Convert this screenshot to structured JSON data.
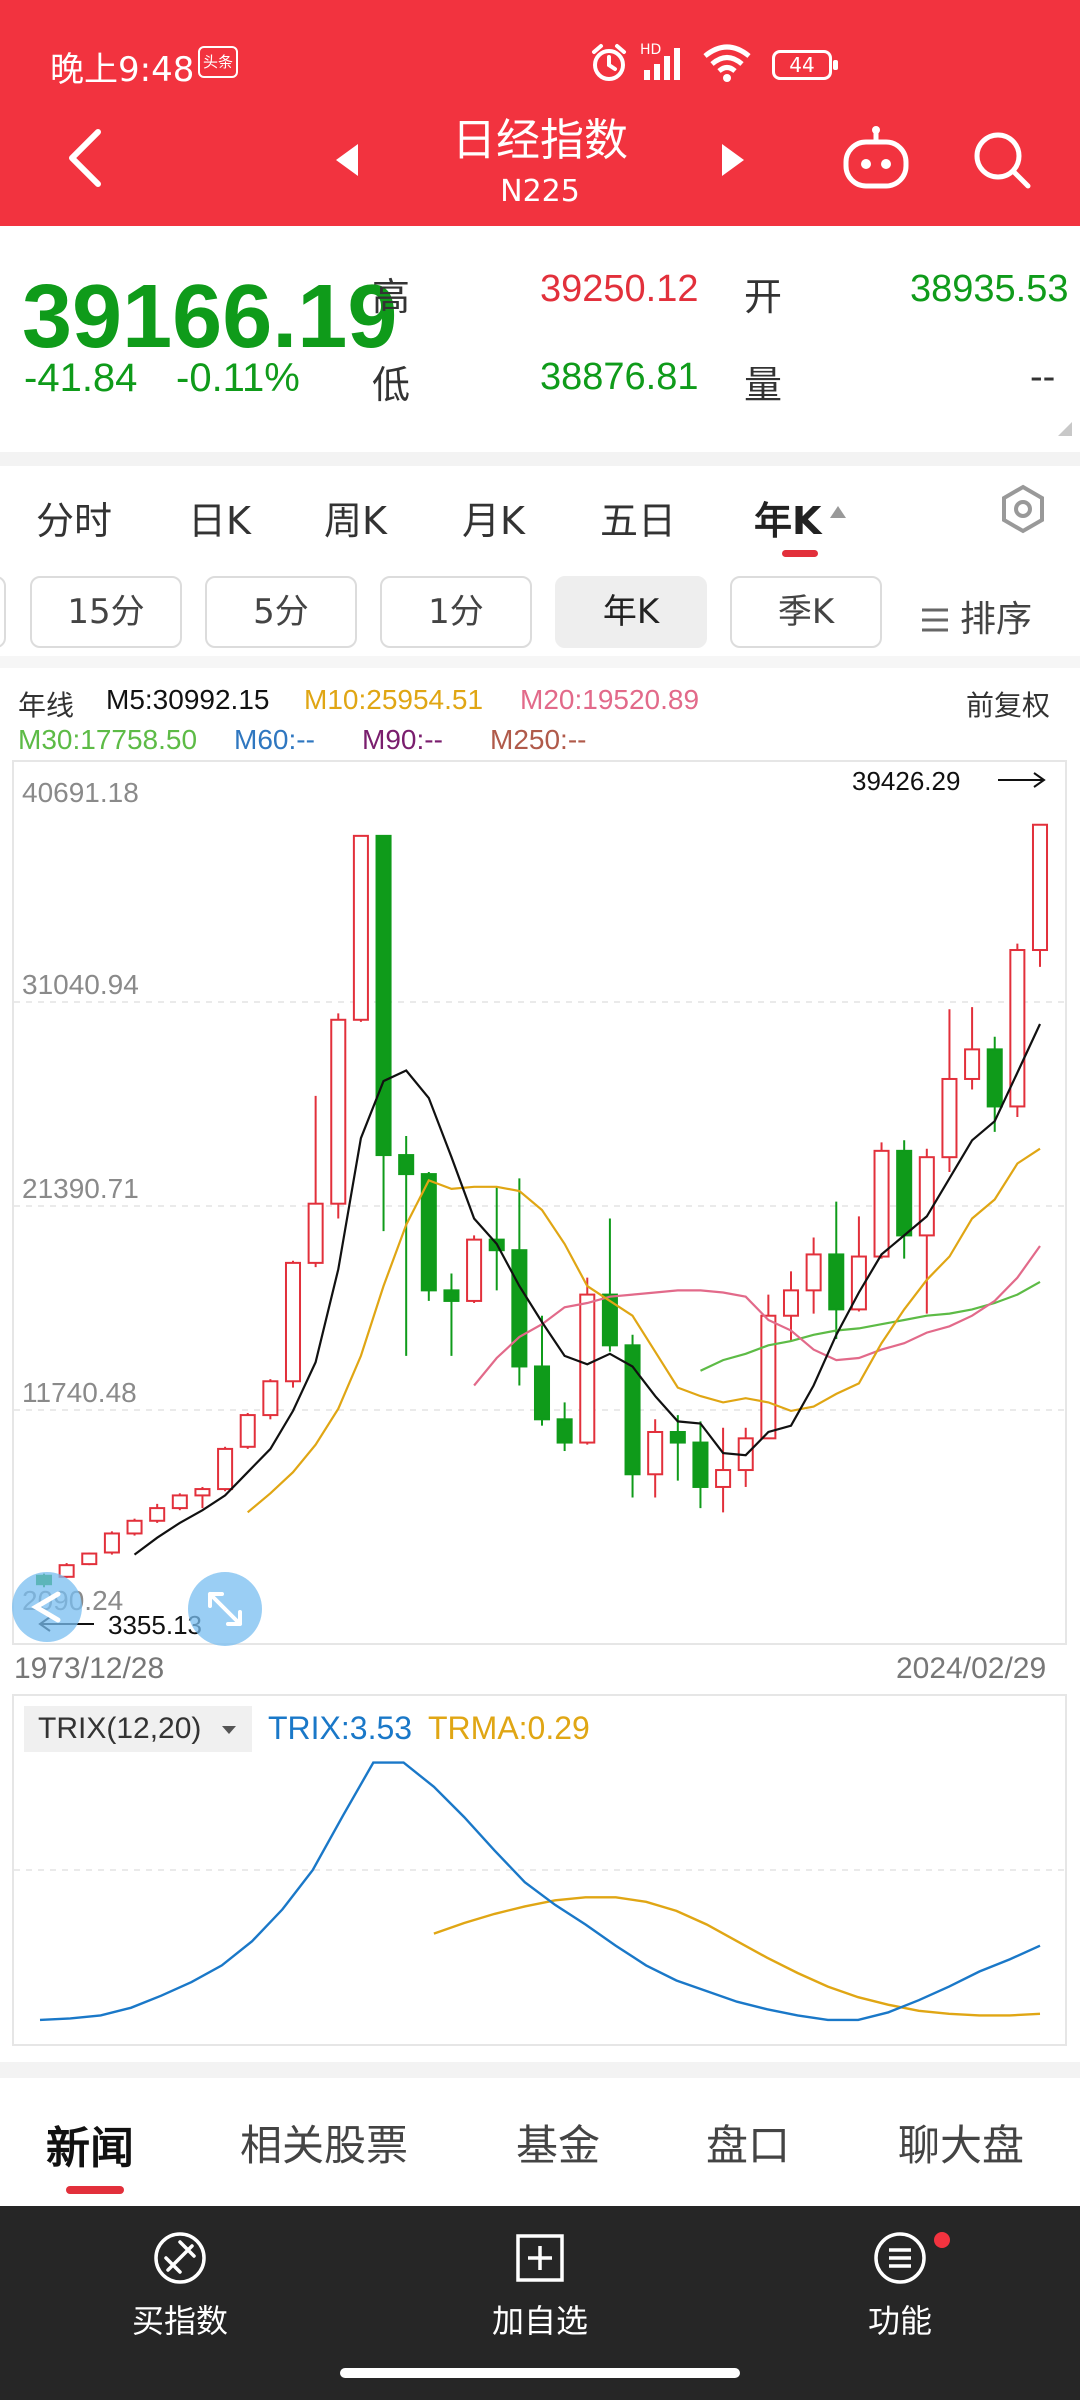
{
  "status_bar": {
    "time": "晚上9:48",
    "app_badge": "头条",
    "network": "HD",
    "battery": "44"
  },
  "nav": {
    "title": "日经指数",
    "subtitle": "N225"
  },
  "quote": {
    "price": "39166.19",
    "change": "-41.84",
    "change_pct": "-0.11%",
    "high_label": "高",
    "high": "39250.12",
    "open_label": "开",
    "open": "38935.53",
    "low_label": "低",
    "low": "38876.81",
    "volume_label": "量",
    "volume": "--"
  },
  "period_tabs": [
    "分时",
    "日K",
    "周K",
    "月K",
    "五日",
    "年K"
  ],
  "active_period": "年K",
  "sub_tabs": [
    "15分",
    "5分",
    "1分",
    "年K",
    "季K"
  ],
  "sort_label": "排序",
  "ma_legend": {
    "type_label": "年线",
    "m5": "M5:30992.15",
    "m10": "M10:25954.51",
    "m20": "M20:19520.89",
    "m30": "M30:17758.50",
    "m60": "M60:--",
    "m90": "M90:--",
    "m250": "M250:--",
    "adjust": "前复权"
  },
  "colors": {
    "brand_red": "#f2333f",
    "rise": "#e2303b",
    "fall": "#0f9b1a",
    "m5": "#111111",
    "m10": "#e0a614",
    "m20": "#e26a8a",
    "m30": "#5dbb46",
    "m60": "#2f77c0",
    "m90": "#7a1e6e",
    "m250": "#b05a4a",
    "trix": "#1a78c8",
    "trma": "#e0a614"
  },
  "chart_data": {
    "type": "candlestick",
    "y_ticks": [
      "40691.18",
      "31040.94",
      "21390.71",
      "11740.48",
      "2090.24"
    ],
    "ylim": [
      2090.24,
      40691.18
    ],
    "x_start": "1973/12/28",
    "x_end": "2024/02/29",
    "max_label": "39426.29",
    "min_label": "3355.13",
    "candles": [
      {
        "o": 3900,
        "c": 3500,
        "h": 4000,
        "l": 3355
      },
      {
        "o": 3850,
        "c": 4400,
        "h": 4500,
        "l": 3800
      },
      {
        "o": 4450,
        "c": 4950,
        "h": 5000,
        "l": 4400
      },
      {
        "o": 5000,
        "c": 5900,
        "h": 6000,
        "l": 4900
      },
      {
        "o": 5900,
        "c": 6500,
        "h": 6600,
        "l": 5800
      },
      {
        "o": 6500,
        "c": 7100,
        "h": 7300,
        "l": 6400
      },
      {
        "o": 7100,
        "c": 7700,
        "h": 7800,
        "l": 7000
      },
      {
        "o": 7700,
        "c": 8000,
        "h": 8100,
        "l": 7100
      },
      {
        "o": 8000,
        "c": 9900,
        "h": 10000,
        "l": 7900
      },
      {
        "o": 10000,
        "c": 11500,
        "h": 11600,
        "l": 9900
      },
      {
        "o": 11500,
        "c": 13100,
        "h": 13200,
        "l": 11300
      },
      {
        "o": 13100,
        "c": 18700,
        "h": 18800,
        "l": 12800
      },
      {
        "o": 18700,
        "c": 21500,
        "h": 26600,
        "l": 18500
      },
      {
        "o": 21500,
        "c": 30200,
        "h": 30500,
        "l": 20800
      },
      {
        "o": 30200,
        "c": 38900,
        "h": 38900,
        "l": 30100
      },
      {
        "o": 38900,
        "c": 23800,
        "h": 38900,
        "l": 20200
      },
      {
        "o": 23800,
        "c": 22900,
        "h": 24700,
        "l": 14300
      },
      {
        "o": 22900,
        "c": 17400,
        "h": 23000,
        "l": 16900
      },
      {
        "o": 17400,
        "c": 16900,
        "h": 18200,
        "l": 14300
      },
      {
        "o": 16900,
        "c": 19800,
        "h": 20000,
        "l": 16800
      },
      {
        "o": 19800,
        "c": 19300,
        "h": 22300,
        "l": 17400
      },
      {
        "o": 19300,
        "c": 13800,
        "h": 22700,
        "l": 12900
      },
      {
        "o": 13800,
        "c": 11300,
        "h": 16200,
        "l": 11000
      },
      {
        "o": 11300,
        "c": 10200,
        "h": 12100,
        "l": 9800
      },
      {
        "o": 10200,
        "c": 17200,
        "h": 18000,
        "l": 10100
      },
      {
        "o": 17200,
        "c": 14800,
        "h": 20800,
        "l": 14500
      },
      {
        "o": 14800,
        "c": 8700,
        "h": 15300,
        "l": 7600
      },
      {
        "o": 8700,
        "c": 10700,
        "h": 11300,
        "l": 7600
      },
      {
        "o": 10700,
        "c": 10200,
        "h": 11500,
        "l": 8400
      },
      {
        "o": 10200,
        "c": 8100,
        "h": 11200,
        "l": 7100
      },
      {
        "o": 8100,
        "c": 8900,
        "h": 10900,
        "l": 6900
      },
      {
        "o": 8900,
        "c": 10400,
        "h": 10900,
        "l": 8100
      },
      {
        "o": 10400,
        "c": 16200,
        "h": 17200,
        "l": 10400
      },
      {
        "o": 16200,
        "c": 17400,
        "h": 18300,
        "l": 15000
      },
      {
        "o": 17400,
        "c": 19100,
        "h": 19900,
        "l": 16300
      },
      {
        "o": 19100,
        "c": 16500,
        "h": 21600,
        "l": 15100
      },
      {
        "o": 16500,
        "c": 19000,
        "h": 20900,
        "l": 16400
      },
      {
        "o": 19000,
        "c": 24000,
        "h": 24400,
        "l": 18900
      },
      {
        "o": 24000,
        "c": 20000,
        "h": 24500,
        "l": 18900
      },
      {
        "o": 20000,
        "c": 23700,
        "h": 24100,
        "l": 16300
      },
      {
        "o": 23700,
        "c": 27400,
        "h": 30700,
        "l": 23000
      },
      {
        "o": 27400,
        "c": 28800,
        "h": 30800,
        "l": 26900
      },
      {
        "o": 28800,
        "c": 26100,
        "h": 29400,
        "l": 24900
      },
      {
        "o": 26100,
        "c": 33500,
        "h": 33800,
        "l": 25600
      },
      {
        "o": 33500,
        "c": 39426,
        "h": 39426,
        "l": 32700
      }
    ],
    "ma5": [
      null,
      null,
      null,
      null,
      4900,
      5700,
      6400,
      7000,
      7700,
      8800,
      9900,
      11700,
      14000,
      18400,
      24600,
      27300,
      27800,
      26500,
      23700,
      20800,
      19600,
      17600,
      15900,
      14300,
      13900,
      14400,
      13800,
      12400,
      11200,
      11100,
      9700,
      9600,
      10700,
      11000,
      12900,
      15300,
      17300,
      19100,
      20000,
      20900,
      22700,
      24500,
      25400,
      27700,
      30000
    ],
    "ma10": [
      null,
      null,
      null,
      null,
      null,
      null,
      null,
      null,
      null,
      6900,
      7800,
      8800,
      10100,
      11800,
      14300,
      17600,
      20500,
      22600,
      22200,
      22300,
      22300,
      22100,
      21200,
      19600,
      17600,
      16900,
      16200,
      14500,
      12800,
      12400,
      12100,
      12300,
      12100,
      11700,
      11900,
      12500,
      13000,
      14900,
      16500,
      17900,
      19000,
      20800,
      21700,
      23400,
      24100
    ],
    "ma20": [
      null,
      null,
      null,
      null,
      null,
      null,
      null,
      null,
      null,
      null,
      null,
      null,
      null,
      null,
      null,
      null,
      null,
      null,
      null,
      12900,
      14200,
      15200,
      15800,
      16600,
      16800,
      17100,
      17200,
      17300,
      17400,
      17400,
      17300,
      17100,
      16000,
      15500,
      14600,
      14100,
      14200,
      14600,
      14900,
      15400,
      15700,
      16200,
      16900,
      18000,
      19500
    ],
    "ma30": [
      null,
      null,
      null,
      null,
      null,
      null,
      null,
      null,
      null,
      null,
      null,
      null,
      null,
      null,
      null,
      null,
      null,
      null,
      null,
      null,
      null,
      null,
      null,
      null,
      null,
      null,
      null,
      null,
      null,
      13600,
      14100,
      14400,
      14800,
      15000,
      15300,
      15500,
      15600,
      15800,
      16000,
      16200,
      16300,
      16500,
      16800,
      17200,
      17800
    ]
  },
  "trix": {
    "selector": "TRIX(12,20)",
    "trix_label": "TRIX:3.53",
    "trma_label": "TRMA:0.29",
    "trix_series": [
      0.3,
      0.4,
      0.6,
      1.1,
      1.9,
      2.8,
      3.9,
      5.5,
      7.6,
      10.2,
      13.8,
      17.3,
      17.3,
      15.7,
      13.7,
      11.5,
      9.4,
      7.9,
      6.6,
      5.2,
      3.9,
      2.9,
      2.2,
      1.5,
      1.0,
      0.6,
      0.3,
      0.3,
      0.8,
      1.6,
      2.5,
      3.5,
      4.3,
      5.2
    ],
    "trma_series": [
      null,
      null,
      null,
      null,
      null,
      null,
      null,
      null,
      null,
      null,
      null,
      null,
      null,
      6.0,
      6.7,
      7.3,
      7.8,
      8.2,
      8.4,
      8.4,
      8.1,
      7.5,
      6.6,
      5.5,
      4.4,
      3.4,
      2.5,
      1.8,
      1.3,
      0.9,
      0.7,
      0.6,
      0.6,
      0.7
    ]
  },
  "content_tabs": [
    "新闻",
    "相关股票",
    "基金",
    "盘口",
    "聊大盘"
  ],
  "bottom_bar": {
    "buy": "买指数",
    "add": "加自选",
    "func": "功能"
  }
}
